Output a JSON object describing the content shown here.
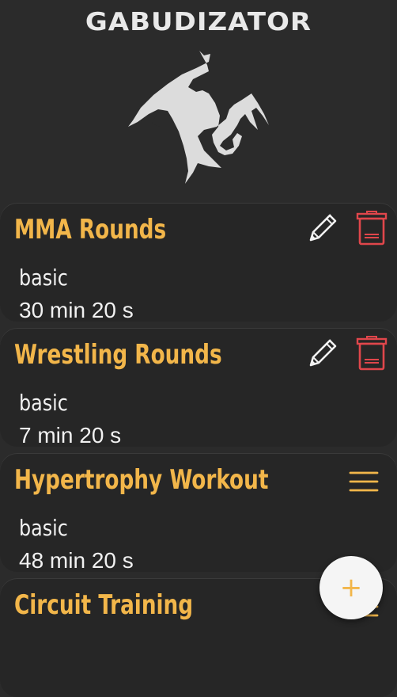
{
  "app": {
    "title": "GABUDIZATOR"
  },
  "colors": {
    "accent": "#f2b64a",
    "danger": "#e0464b",
    "background": "#2b2b2b",
    "card": "#262626",
    "text": "#f1f1f1"
  },
  "workouts": [
    {
      "title": "MMA Rounds",
      "type": "basic",
      "duration": "30 min 20 s",
      "actions": [
        "edit-icon",
        "delete-icon"
      ]
    },
    {
      "title": "Wrestling Rounds",
      "type": "basic",
      "duration": "7 min 20 s",
      "actions": [
        "edit-icon",
        "delete-icon"
      ]
    },
    {
      "title": "Hypertrophy Workout",
      "type": "basic",
      "duration": "48 min 20 s",
      "actions": [
        "menu-icon"
      ]
    },
    {
      "title": "Circuit Training",
      "type": "",
      "duration": "",
      "actions": [
        "menu-icon"
      ]
    }
  ],
  "fab": {
    "label": "+",
    "icon": "plus-icon"
  }
}
